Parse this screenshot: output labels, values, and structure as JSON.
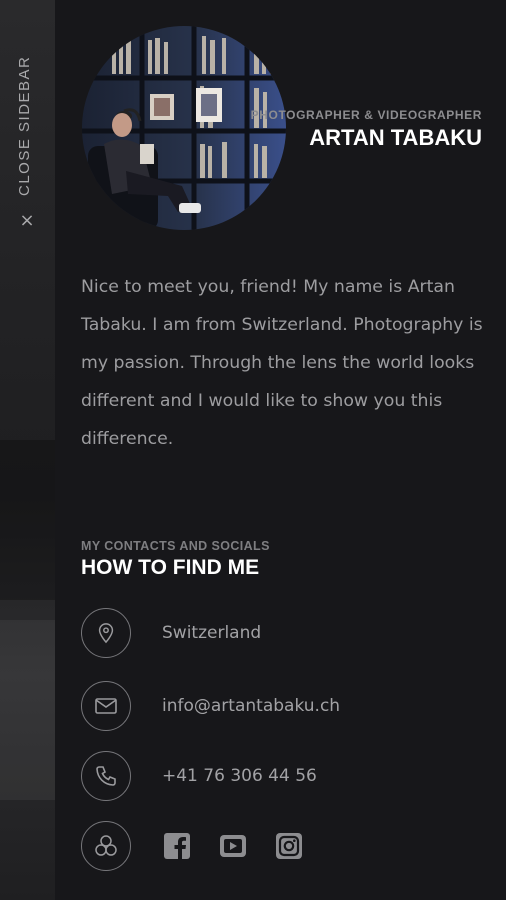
{
  "sidebar_toggle": {
    "label": "CLOSE SIDEBAR",
    "icon": "close-icon",
    "glyph": "×"
  },
  "profile": {
    "role": "PHOTOGRAPHER & VIDEOGRAPHER",
    "name": "ARTAN TABAKU",
    "bio": "Nice to meet you, friend! My name is Artan Tabaku. I am from Switzerland. Photography is my passion. Through the lens the world looks different and I would like to show you this difference."
  },
  "contacts": {
    "subtitle": "MY CONTACTS AND SOCIALS",
    "title": "HOW TO FIND ME",
    "items": [
      {
        "icon": "location-pin-icon",
        "text": "Switzerland"
      },
      {
        "icon": "envelope-icon",
        "text": "info@artantabaku.ch"
      },
      {
        "icon": "phone-icon",
        "text": "+41 76 306 44 56"
      }
    ],
    "socials_icon": "share-icon",
    "socials": [
      {
        "icon": "facebook-icon"
      },
      {
        "icon": "youtube-icon"
      },
      {
        "icon": "instagram-icon"
      }
    ]
  },
  "colors": {
    "panel_bg": "#17171a",
    "accent_white": "#ffffff",
    "muted_text": "#9d9da0",
    "icon_stroke": "#76767a"
  }
}
